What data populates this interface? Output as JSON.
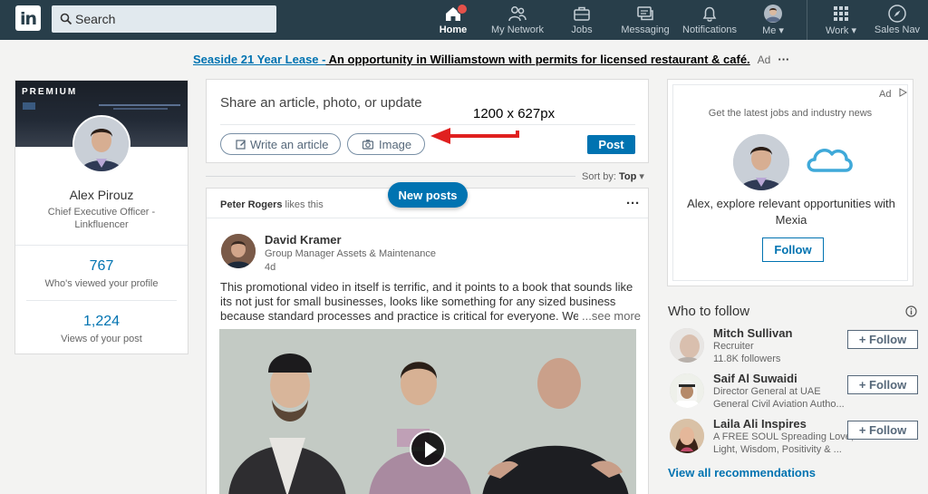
{
  "nav": {
    "logo": "in",
    "search_placeholder": "Search",
    "items": [
      {
        "label": "Home",
        "icon": "home-icon"
      },
      {
        "label": "My Network",
        "icon": "network-icon"
      },
      {
        "label": "Jobs",
        "icon": "briefcase-icon"
      },
      {
        "label": "Messaging",
        "icon": "messaging-icon"
      },
      {
        "label": "Notifications",
        "icon": "bell-icon"
      },
      {
        "label": "Me",
        "icon": "avatar"
      },
      {
        "label": "Work",
        "icon": "grid-icon"
      },
      {
        "label": "Sales Nav",
        "icon": "compass-icon"
      }
    ]
  },
  "ad_banner": {
    "link": "Seaside 21 Year Lease -",
    "text": " An opportunity in Williamstown with permits for licensed restaurant & café.",
    "tag": "Ad",
    "more": "···"
  },
  "profile": {
    "premium": "PREMIUM",
    "name": "Alex Pirouz",
    "title": "Chief Executive Officer - Linkfluencer",
    "views_count": "767",
    "views_label": "Who's viewed your profile",
    "post_views_count": "1,224",
    "post_views_label": "Views of your post"
  },
  "share": {
    "prompt": "Share an article, photo, or update",
    "write_article": "Write an article",
    "image": "Image",
    "post": "Post",
    "annotation": "1200 x 627px"
  },
  "sort": {
    "label": "Sort by:",
    "value": "Top"
  },
  "new_posts": "New posts",
  "feed_item": {
    "liker": "Peter Rogers",
    "liker_suffix": " likes this",
    "more": "···",
    "author": "David Kramer",
    "role": "Group Manager Assets & Maintenance",
    "time": "4d",
    "text": "This promotional video in itself is terrific, and it points to a book that sounds like its not just for small businesses, looks like something for any sized business because standard processes and practice is critical for everyone.  We find in larg",
    "see_more": "...see more"
  },
  "right_ad": {
    "tag": "Ad",
    "heading": "Get the latest jobs and industry news",
    "text": "Alex, explore relevant opportunities with Mexia",
    "follow": "Follow"
  },
  "who_to_follow": {
    "heading": "Who to follow",
    "people": [
      {
        "name": "Mitch Sullivan",
        "line1": "Recruiter",
        "line2": "11.8K followers",
        "button": "+ Follow"
      },
      {
        "name": "Saif Al Suwaidi",
        "line1": "Director General at UAE",
        "line2": "General Civil Aviation Autho...",
        "button": "+ Follow"
      },
      {
        "name": "Laila Ali Inspires",
        "line1": "A FREE SOUL Spreading Love,",
        "line2": "Light, Wisdom, Positivity & ...",
        "button": "+ Follow"
      }
    ],
    "view_all": "View all recommendations"
  },
  "colors": {
    "nav_bg": "#283e4a",
    "accent": "#0073b1",
    "annotation_arrow": "#e0201f"
  }
}
